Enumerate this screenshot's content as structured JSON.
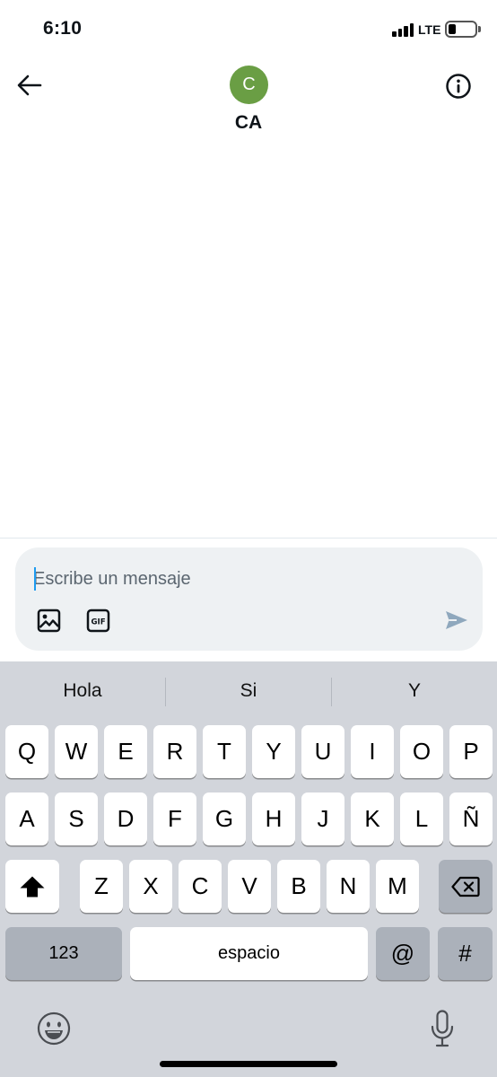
{
  "status_bar": {
    "time": "6:10",
    "network": "LTE"
  },
  "header": {
    "avatar_initial": "C",
    "contact_name": "CA"
  },
  "composer": {
    "placeholder": "Escribe un mensaje"
  },
  "suggestions": [
    "Hola",
    "Si",
    "Y"
  ],
  "keyboard": {
    "row1": [
      "Q",
      "W",
      "E",
      "R",
      "T",
      "Y",
      "U",
      "I",
      "O",
      "P"
    ],
    "row2": [
      "A",
      "S",
      "D",
      "F",
      "G",
      "H",
      "J",
      "K",
      "L",
      "Ñ"
    ],
    "row3": [
      "Z",
      "X",
      "C",
      "V",
      "B",
      "N",
      "M"
    ],
    "numbers_label": "123",
    "space_label": "espacio",
    "at_label": "@",
    "hash_label": "#"
  },
  "colors": {
    "avatar": "#6a9e44",
    "composer_bg": "#eef1f3",
    "keyboard_bg": "#d2d5db",
    "send_icon": "#8fa8bd"
  },
  "icons": [
    "back-arrow-icon",
    "info-icon",
    "image-icon",
    "gif-icon",
    "send-icon",
    "shift-icon",
    "backspace-icon",
    "emoji-icon",
    "microphone-icon"
  ]
}
